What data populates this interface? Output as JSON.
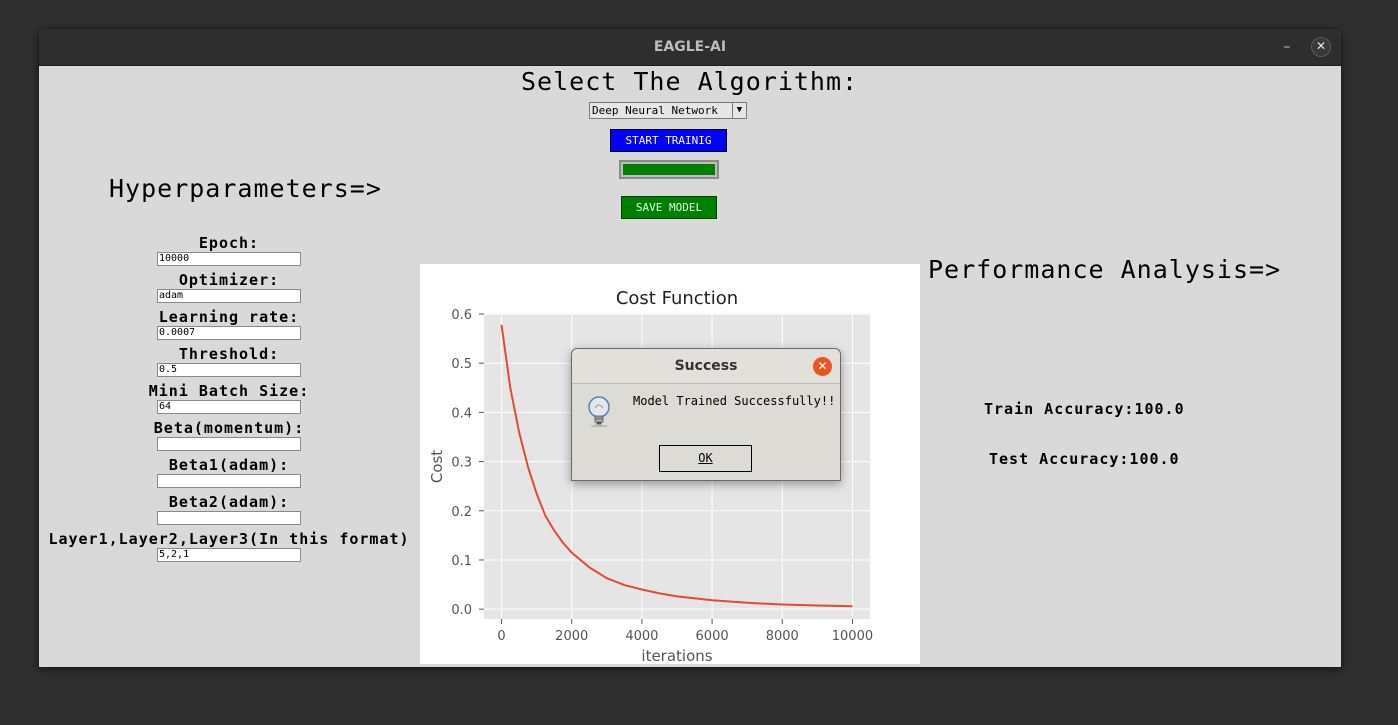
{
  "window": {
    "title": "EAGLE-AI",
    "minimize_glyph": "–",
    "close_glyph": "✕"
  },
  "algorithm": {
    "heading": "Select The Algorithm:",
    "selected": "Deep Neural Network",
    "dropdown_glyph": "▼"
  },
  "controls": {
    "start_label": "START TRAINIG",
    "progress": 1.0,
    "save_label": "SAVE MODEL",
    "accent_blue": "#0000ff",
    "accent_green": "#008000"
  },
  "hyperparameters": {
    "heading": "Hyperparameters=>",
    "fields": [
      {
        "label": "Epoch:",
        "value": "10000"
      },
      {
        "label": "Optimizer:",
        "value": "adam"
      },
      {
        "label": "Learning rate:",
        "value": "0.0007"
      },
      {
        "label": "Threshold:",
        "value": "0.5"
      },
      {
        "label": "Mini Batch Size:",
        "value": "64"
      },
      {
        "label": "Beta(momentum):",
        "value": ""
      },
      {
        "label": "Beta1(adam):",
        "value": ""
      },
      {
        "label": "Beta2(adam):",
        "value": ""
      },
      {
        "label": "Layer1,Layer2,Layer3(In this format)",
        "value": "5,2,1"
      }
    ]
  },
  "performance": {
    "heading": "Performance Analysis=>",
    "train_accuracy": "Train Accuracy:100.0",
    "test_accuracy": "Test Accuracy:100.0"
  },
  "chart_data": {
    "type": "line",
    "title": "Cost Function",
    "xlabel": "iterations",
    "ylabel": "Cost",
    "xlim": [
      -500,
      10500
    ],
    "ylim": [
      -0.02,
      0.6
    ],
    "xticks": [
      0,
      2000,
      4000,
      6000,
      8000,
      10000
    ],
    "yticks": [
      0.0,
      0.1,
      0.2,
      0.3,
      0.4,
      0.5,
      0.6
    ],
    "grid": true,
    "line_color": "#e24a33",
    "background": "#e5e5e5",
    "series": [
      {
        "x": [
          0,
          250,
          500,
          750,
          1000,
          1250,
          1500,
          1750,
          2000,
          2500,
          3000,
          3500,
          4000,
          4500,
          5000,
          6000,
          7000,
          8000,
          9000,
          10000
        ],
        "values": [
          0.578,
          0.45,
          0.36,
          0.29,
          0.235,
          0.19,
          0.16,
          0.135,
          0.115,
          0.085,
          0.063,
          0.049,
          0.04,
          0.032,
          0.026,
          0.018,
          0.013,
          0.0095,
          0.0075,
          0.006
        ]
      }
    ]
  },
  "dialog": {
    "title": "Success",
    "message": "Model Trained Successfully!!",
    "ok_label": "OK",
    "close_glyph": "✕",
    "icon": "lightbulb-icon"
  }
}
